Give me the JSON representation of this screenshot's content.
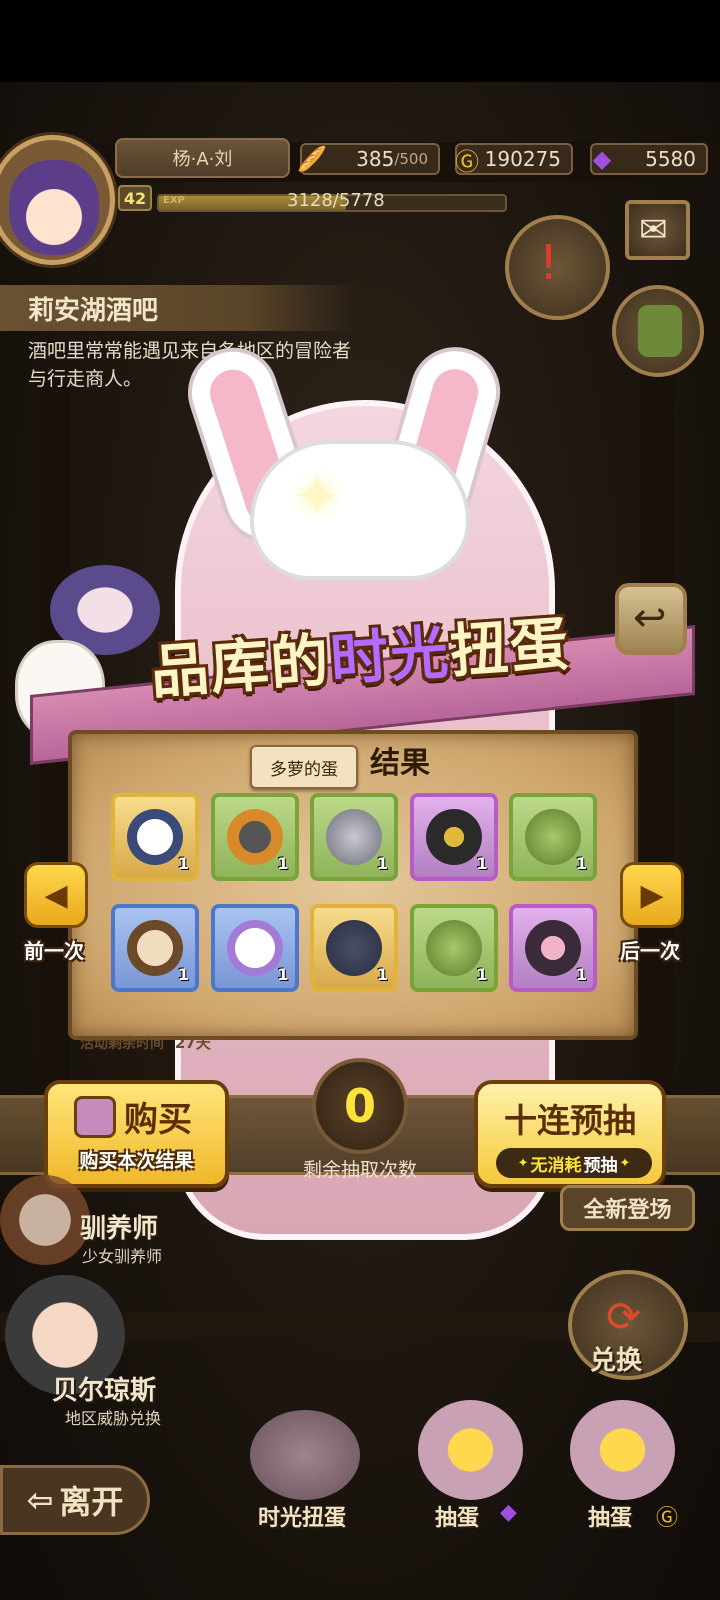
{
  "header": {
    "player_name": "杨·A·刘",
    "level": "42",
    "exp_label": "EXP",
    "exp_text": "3128/5778",
    "exp_fraction": 0.541,
    "stamina": "385",
    "stamina_max": "/500",
    "gold": "190275",
    "gems": "5580"
  },
  "location": {
    "title": "莉安湖酒吧",
    "description": "酒吧里常常能遇见来自各地区的冒险者与行走商人。"
  },
  "gacha": {
    "title_part1": "品库的",
    "title_part2": "时光",
    "title_part3": "扭蛋",
    "panel_title": "结果",
    "tooltip": "多萝的蛋",
    "prev_label": "前一次",
    "next_label": "后一次",
    "timer_label": "活动剩余时间",
    "timer_value": "27天",
    "items": [
      {
        "name": "white-fur-cloak",
        "rarity": "gold",
        "qty": "1"
      },
      {
        "name": "hat",
        "rarity": "green",
        "qty": "1"
      },
      {
        "name": "gray-egg",
        "rarity": "green",
        "qty": "1"
      },
      {
        "name": "anubis-mask",
        "rarity": "purple",
        "qty": "1"
      },
      {
        "name": "seed-sprout",
        "rarity": "green",
        "qty": "1"
      },
      {
        "name": "fur-hat",
        "rarity": "blue",
        "qty": "1"
      },
      {
        "name": "white-egg",
        "rarity": "blue",
        "qty": "1"
      },
      {
        "name": "dark-egg",
        "rarity": "gold",
        "qty": "1"
      },
      {
        "name": "seed-sprout",
        "rarity": "green",
        "qty": "1"
      },
      {
        "name": "demon-cape",
        "rarity": "purple",
        "qty": "1"
      }
    ]
  },
  "actions": {
    "buy_label": "购买",
    "buy_sub": "购买本次结果",
    "remaining_count": "0",
    "remaining_label": "剩余抽取次数",
    "ten_label": "十连预抽",
    "ten_sub_hl": "无消耗",
    "ten_sub": "预抽"
  },
  "background_ui": {
    "new_tag": "全新登场",
    "npc1_name": "驯养师",
    "npc1_sub": "少女驯养师",
    "npc2_name": "贝尔琼斯",
    "npc2_sub": "地区威胁兑换",
    "exchange_label": "兑换",
    "leave_label": "离开",
    "bottom1": "时光扭蛋",
    "bottom2": "抽蛋",
    "bottom3": "抽蛋"
  },
  "colors": {
    "rarity_gold": "#e0b43a",
    "rarity_green": "#7aa43a",
    "rarity_purple": "#b75cc7",
    "rarity_blue": "#4d78c9",
    "count_color": "#ffe33b"
  }
}
